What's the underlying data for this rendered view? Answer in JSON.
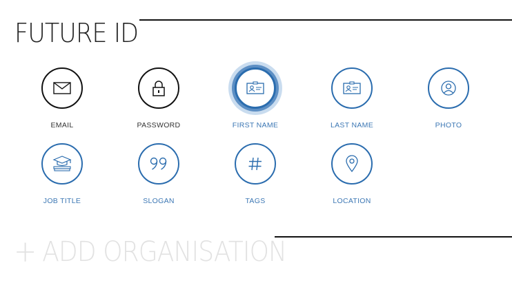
{
  "title": "FUTURE ID",
  "fields": {
    "email": "EMAIL",
    "password": "PASSWORD",
    "first_name": "FIRST NAME",
    "last_name": "LAST NAME",
    "photo": "PHOTO",
    "job_title": "JOB TITLE",
    "slogan": "SLOGAN",
    "tags": "TAGS",
    "location": "LOCATION"
  },
  "add_org": {
    "plus": "+",
    "label": "ADD ORGANISATION"
  },
  "colors": {
    "accent": "#2a6cae",
    "dark": "#111111",
    "muted": "#e2e2e2"
  }
}
